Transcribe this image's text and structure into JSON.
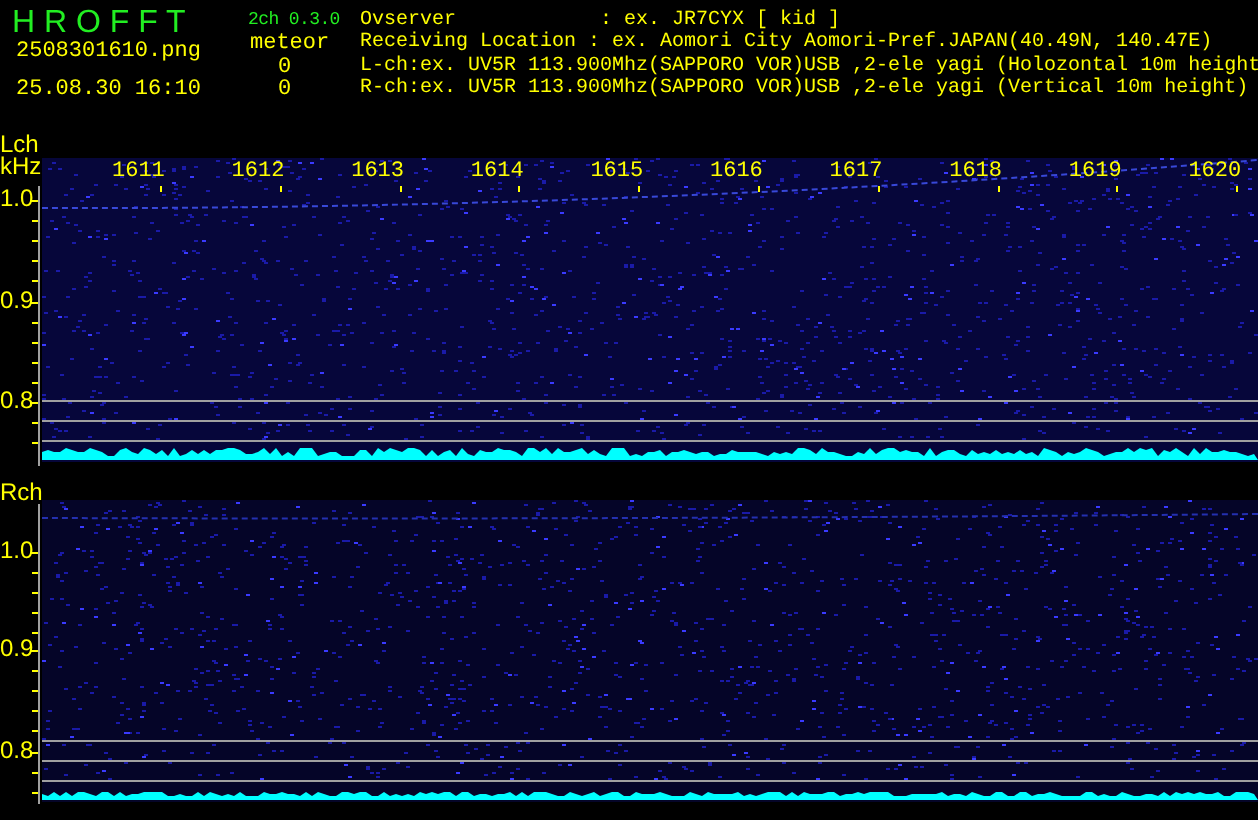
{
  "header": {
    "app_title": "H R O F F T",
    "version": "2ch 0.3.0",
    "filename": "2508301610.png",
    "datetime": "25.08.30 16:10",
    "meteor_label": "meteor",
    "meteor_counts": [
      "0",
      "0"
    ],
    "info_lines": [
      "Ovserver            : ex. JR7CYX [ kid ]",
      "Receiving Location : ex. Aomori City Aomori-Pref.JAPAN(40.49N, 140.47E)",
      "L-ch:ex. UV5R 113.900Mhz(SAPPORO VOR)USB ,2-ele yagi (Holozontal 10m height",
      "R-ch:ex. UV5R 113.900Mhz(SAPPORO VOR)USB ,2-ele yagi (Vertical 10m height)"
    ]
  },
  "time_labels": [
    "1611",
    "1612",
    "1613",
    "1614",
    "1615",
    "1616",
    "1617",
    "1618",
    "1619",
    "1620"
  ],
  "channels": [
    {
      "label": "Lch",
      "unit": "kHz",
      "ticks": [
        "1.0",
        "0.9",
        "0.8"
      ]
    },
    {
      "label": "Rch",
      "ticks": [
        "1.0",
        "0.9",
        "0.8"
      ]
    }
  ]
}
